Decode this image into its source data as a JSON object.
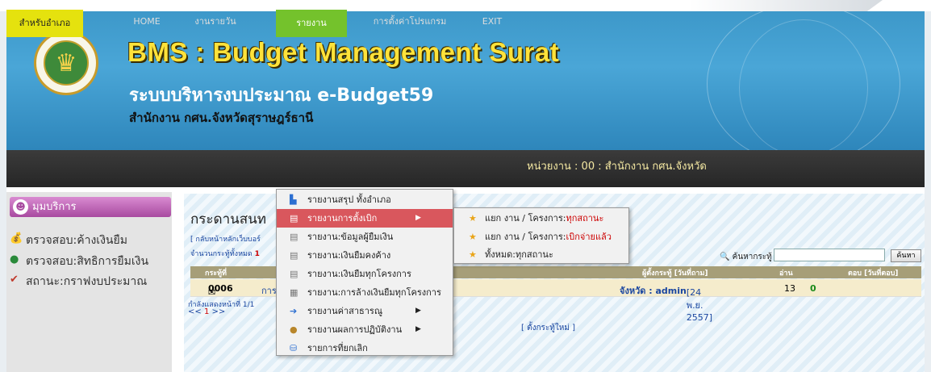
{
  "header": {
    "title": "BMS : Budget Management Surat",
    "subtitle": "ระบบบริหารงบประมาณ e-Budget59",
    "office": "สำนักงาน กศน.จังหวัดสุราษฎร์ธานี"
  },
  "nav": {
    "items": [
      "สำหรับอำเภอ",
      "HOME",
      "งานรายวัน",
      "รายงาน",
      "การตั้งค่าโปรแกรม",
      "EXIT"
    ],
    "unit": "หน่วยงาน : 00 : สำนักงาน กศน.จังหวัด"
  },
  "sidebar": {
    "heading": "มุมบริการ",
    "items": [
      "ตรวจสอบ:ค้างเงินยืม",
      "ตรวจสอบ:สิทธิการยืมเงิน",
      "สถานะ:กราฟงบประมาณ"
    ]
  },
  "main": {
    "title_visible": "กระดานสนท",
    "back_link": "[ กลับหน้าหลักเว็บบอร์",
    "count_label": "จำนวนกระทู้ทั้งหมด",
    "count_value": "1",
    "search_label": "ค้นหากระทู้",
    "search_button": "ค้นหา",
    "headers": {
      "topic": "กระทู้ที่",
      "poster": "ผู้ตั้งกระทู้ [วันที่ถาม]",
      "reads": "อ่าน",
      "reply": "ตอบ [วันที่ตอบ]"
    },
    "row": {
      "id": "0006",
      "topic_prefix": "การ",
      "poster_name": "จังหวัด : admin",
      "poster_date": "[24 พ.ย. 2557]",
      "reads": "13",
      "replies": "0"
    },
    "pager_text": "กำลังแสดงหน้าที่ 1/1",
    "pager_nav": [
      "<<",
      "1",
      ">>"
    ],
    "new_topic": "[ ตั้งกระทู้ใหม่ ]"
  },
  "report_menu": {
    "items": [
      {
        "label": "รายงานสรุป ทั้งอำเภอ",
        "icon": "chart-icon",
        "submenu": false
      },
      {
        "label": "รายงานการตั้งเบิก",
        "icon": "document-icon",
        "submenu": true
      },
      {
        "label": "รายงาน:ข้อมูลผู้ยืมเงิน",
        "icon": "document-icon",
        "submenu": false
      },
      {
        "label": "รายงาน:เงินยืมคงค้าง",
        "icon": "document-icon",
        "submenu": false
      },
      {
        "label": "รายงาน:เงินยืมทุกโครงการ",
        "icon": "document-icon",
        "submenu": false
      },
      {
        "label": "รายงาน:การล้างเงินยืมทุกโครงการ",
        "icon": "document-edit-icon",
        "submenu": false
      },
      {
        "label": "รายงานค่าสาธารณู",
        "icon": "arrow-icon",
        "submenu": true
      },
      {
        "label": "รายงานผลการปฏิบัติงาน",
        "icon": "money-bag-icon",
        "submenu": true
      },
      {
        "label": "รายการที่ยกเลิก",
        "icon": "database-icon",
        "submenu": false
      }
    ]
  },
  "submenu": {
    "items": [
      {
        "prefix": "แยก งาน / โครงการ:",
        "highlight": "ทุกสถานะ"
      },
      {
        "prefix": "แยก งาน / โครงการ:",
        "highlight": "เบิกจ่ายแล้ว"
      },
      {
        "prefix": "ทั้งหมด:ทุกสถานะ",
        "highlight": ""
      }
    ]
  }
}
